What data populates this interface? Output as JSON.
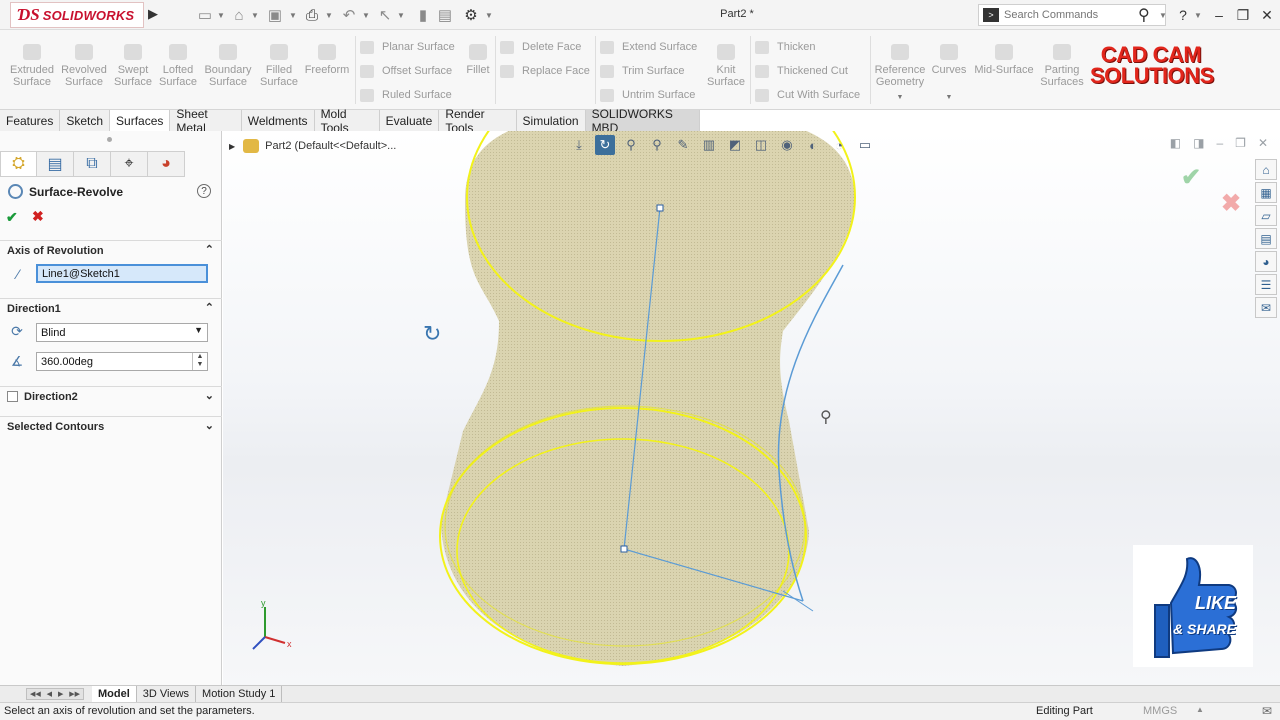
{
  "app": {
    "logo_text": "SOLIDWORKS",
    "logo_ds": "ƊS",
    "document_title": "Part2 *"
  },
  "search": {
    "placeholder": "Search Commands"
  },
  "ribbon": {
    "big_commands": [
      {
        "label": "Extruded Surface"
      },
      {
        "label": "Revolved Surface"
      },
      {
        "label": "Swept Surface"
      },
      {
        "label": "Lofted Surface"
      },
      {
        "label": "Boundary Surface"
      },
      {
        "label": "Filled Surface"
      },
      {
        "label": "Freeform"
      }
    ],
    "group1": [
      "Planar Surface",
      "Offset Surface",
      "Ruled Surface"
    ],
    "fillet_label": "Fillet",
    "group2": [
      "Delete Face",
      "Replace Face"
    ],
    "group3": [
      "Extend Surface",
      "Trim Surface",
      "Untrim Surface"
    ],
    "knit_label": "Knit Surface",
    "group4": [
      "Thicken",
      "Thickened Cut",
      "Cut With Surface"
    ],
    "reference_geometry": "Reference Geometry",
    "curves": "Curves",
    "mid_surface": "Mid-Surface",
    "parting_surfaces": "Parting Surfaces",
    "brand_line1": "CAD CAM",
    "brand_line2": "SOLUTIONS",
    "brand_color": "#e2261c"
  },
  "tabs": [
    {
      "label": "Features"
    },
    {
      "label": "Sketch"
    },
    {
      "label": "Surfaces"
    },
    {
      "label": "Sheet Metal"
    },
    {
      "label": "Weldments"
    },
    {
      "label": "Mold Tools"
    },
    {
      "label": "Evaluate"
    },
    {
      "label": "Render Tools"
    },
    {
      "label": "Simulation"
    },
    {
      "label": "SOLIDWORKS MBD"
    }
  ],
  "active_tab": "Surfaces",
  "property_manager": {
    "title": "Surface-Revolve",
    "help_glyph": "?",
    "axis_section": "Axis of Revolution",
    "axis_value": "Line1@Sketch1",
    "direction1_section": "Direction1",
    "direction1_type": "Blind",
    "direction1_angle": "360.00deg",
    "direction2_section": "Direction2",
    "direction2_checked": false,
    "selected_contours_section": "Selected Contours"
  },
  "graphics": {
    "tree_root": "Part2  (Default<<Default>...",
    "surface_color": "#d9d2ac",
    "edge_highlight": "#f2f21a",
    "sketch_color": "#5b9bd5",
    "badge_like": "LIKE",
    "badge_share": "& SHARE"
  },
  "model_tabs": [
    {
      "label": "Model"
    },
    {
      "label": "3D Views"
    },
    {
      "label": "Motion Study 1"
    }
  ],
  "status": {
    "message": "Select an axis of revolution and set the parameters.",
    "mode": "Editing Part",
    "units": "MMGS"
  }
}
